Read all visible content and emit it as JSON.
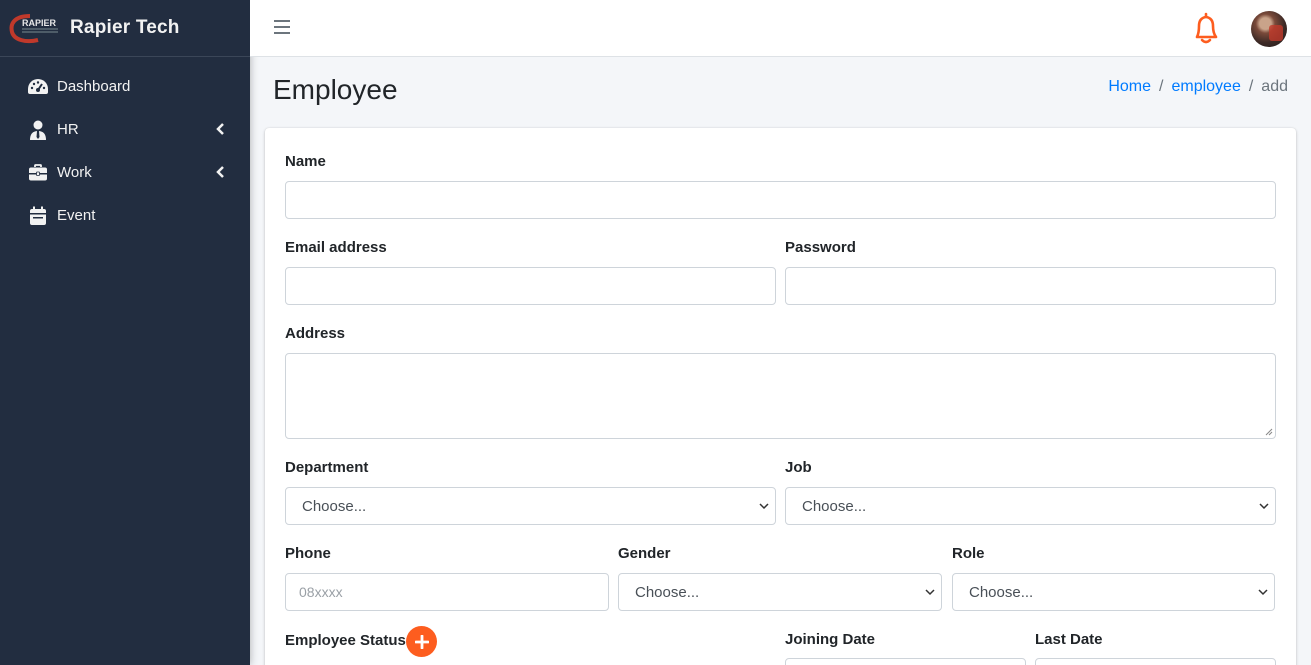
{
  "brand": {
    "name": "Rapier Tech",
    "logo_text": "RAPIER"
  },
  "sidebar": {
    "items": [
      {
        "label": "Dashboard",
        "icon": "dashboard-icon"
      },
      {
        "label": "HR",
        "icon": "user-tie-icon",
        "expandable": true
      },
      {
        "label": "Work",
        "icon": "briefcase-icon",
        "expandable": true
      },
      {
        "label": "Event",
        "icon": "calendar-icon"
      }
    ]
  },
  "topbar": {
    "menu_icon": "hamburger-icon",
    "notification_icon": "bell-icon",
    "accent": "#fd5d1f"
  },
  "page": {
    "title": "Employee"
  },
  "breadcrumb": {
    "home": "Home",
    "section": "employee",
    "current": "add",
    "sep": "/"
  },
  "form": {
    "name": {
      "label": "Name",
      "value": ""
    },
    "email": {
      "label": "Email address",
      "value": ""
    },
    "password": {
      "label": "Password",
      "value": ""
    },
    "address": {
      "label": "Address",
      "value": ""
    },
    "department": {
      "label": "Department",
      "selected": "Choose..."
    },
    "job": {
      "label": "Job",
      "selected": "Choose..."
    },
    "phone": {
      "label": "Phone",
      "placeholder": "08xxxx"
    },
    "gender": {
      "label": "Gender",
      "selected": "Choose..."
    },
    "role": {
      "label": "Role",
      "selected": "Choose..."
    },
    "employee_status": {
      "label": "Employee Status"
    },
    "joining_date": {
      "label": "Joining Date"
    },
    "last_date": {
      "label": "Last Date"
    }
  },
  "colors": {
    "sidebar_bg": "#222d40",
    "link": "#007bff",
    "accent": "#fd5d1f"
  }
}
